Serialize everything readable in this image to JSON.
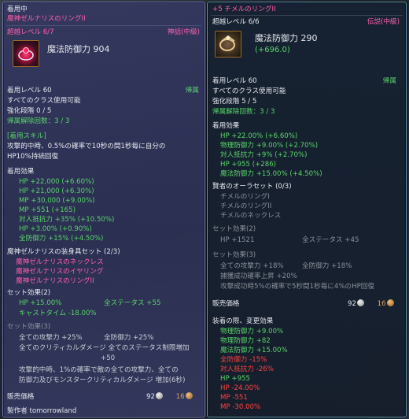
{
  "left": {
    "equipped": "着用中",
    "name": "魔神ゼルナリスのリングII",
    "over_level": "超越レベル 6/7",
    "grade": "神話(中級)",
    "main_stat": "魔法防御力 904",
    "wear_level": "着用レベル 60",
    "bind": "帰属",
    "class": "すべてのクラス使用可能",
    "enhance": "強化段階 0 / 5",
    "unbind": "帰属解除回数：3 / 3",
    "skill_header": "[着用スキル]",
    "skill_desc_1": "攻撃的中時、0.5%の確率で10秒の間1秒毎に自分の",
    "skill_desc_2": "HP10%持続回復",
    "effect_header": "着用効果",
    "effects": [
      {
        "text": "HP +22,000 (+6.60%)"
      },
      {
        "text": "HP +21,000 (+6.30%)"
      },
      {
        "text": "MP +30,000 (+9.00%)"
      },
      {
        "text": "MP +551 (+165)"
      },
      {
        "text": "対人抵抗力 +35% (+10.50%)"
      },
      {
        "text": "HP +3.00% (+0.90%)"
      },
      {
        "text": "全防御力 +15% (+4.50%)"
      }
    ],
    "set_header": "魔神ゼルナリスの装身具セット (2/3)",
    "set_items": [
      "魔神ゼルナリスのネックレス",
      "魔神ゼルナリスのイヤリング",
      "魔神ゼルナリスのリングII"
    ],
    "set_effect_2_header": "セット効果(2)",
    "set_effect_2": {
      "hp": "HP +15.00%",
      "all_stats": "全ステータス +55",
      "cast": "キャストタイム -18.00%"
    },
    "set_effect_3_header": "セット効果(3)",
    "set_effect_3": {
      "atk": "全ての攻撃力 +25%",
      "def": "全防御力 +25%",
      "crit_1": "全てのクリティカルダメージ 全てのステータス制限増加",
      "crit_2": "+50",
      "proc_1": "攻撃的中時、1%の確率で敵の全ての攻撃力、全ての",
      "proc_2": "防御力及びモンスタークリティカルダメージ 増加(6秒)"
    },
    "sell_label": "販売価格",
    "sell_silver": "92",
    "sell_bronze": "16",
    "maker": "製作者 tomorrowland"
  },
  "right": {
    "name": "+5 チメルのリングII",
    "over_level": "超越レベル 6/6",
    "grade": "伝説(中級)",
    "main_stat": "魔法防御力 290",
    "main_bonus": "(+696.0)",
    "wear_level": "着用レベル 60",
    "bind": "帰属",
    "class": "すべてのクラス使用可能",
    "enhance": "強化段階 5 / 5",
    "unbind": "帰属解除回数：3 / 3",
    "effect_header": "着用効果",
    "effects": [
      {
        "text": "HP +22.00% (+6.60%)"
      },
      {
        "text": "物理防御力 +9.00% (+2.70%)"
      },
      {
        "text": "対人抵抗力 +9% (+2.70%)"
      },
      {
        "text": "HP +955 (+286)"
      },
      {
        "text": "魔法防御力 +15.00% (+4.50%)"
      }
    ],
    "aura_header": "賢者のオーラセット (0/3)",
    "aura_items": [
      "チメルのリングI",
      "チメルのリングII",
      "チメルのネックレス"
    ],
    "set_effect_2_header": "セット効果(2)",
    "set_effect_2": {
      "hp": "HP +1521",
      "all_stats": "全ステータス +45"
    },
    "set_effect_3_header": "セット効果(3)",
    "set_effect_3": {
      "atk": "全ての攻撃力 +18%",
      "def": "全防御力 +18%",
      "cap": "捕獲成功確率上昇 +20%",
      "proc": "攻撃成功時5%の確率で5秒間1秒毎に4%のHP回復"
    },
    "sell_label": "販売価格",
    "sell_silver": "92",
    "sell_bronze": "16",
    "changes_header": "装着の際、変更効果",
    "changes": [
      {
        "text": "物理防御力 +9.00%",
        "kind": "up"
      },
      {
        "text": "物理防御力 +82",
        "kind": "up"
      },
      {
        "text": "魔法防御力 +15.00%",
        "kind": "up"
      },
      {
        "text": "全防御力 -15%",
        "kind": "down"
      },
      {
        "text": "対人抵抗力 -26%",
        "kind": "down"
      },
      {
        "text": "HP +955",
        "kind": "up"
      },
      {
        "text": "HP -24.00%",
        "kind": "down"
      },
      {
        "text": "MP -551",
        "kind": "down"
      },
      {
        "text": "MP -30.00%",
        "kind": "down"
      }
    ]
  },
  "colors": {
    "green": "#58d46a",
    "pink": "#ff5fae",
    "red": "#ff4040",
    "gray": "#8a8f99"
  },
  "icons": {
    "left_item": "ruby-ring-icon",
    "right_item": "gold-ring-icon",
    "silver": "silver-coin-icon",
    "bronze": "bronze-coin-icon"
  }
}
